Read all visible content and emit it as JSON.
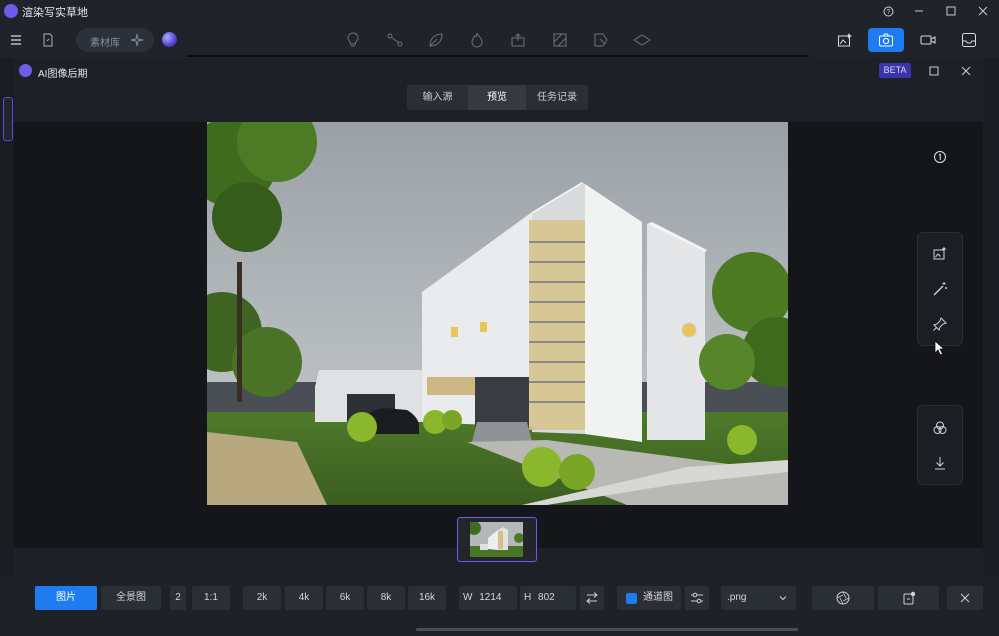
{
  "app": {
    "title": "渲染写实草地"
  },
  "toolbar": {
    "search_label": "素材库"
  },
  "dialog": {
    "title": "AI图像后期",
    "badge": "BETA",
    "tabs": [
      {
        "label": "输入源"
      },
      {
        "label": "预览"
      },
      {
        "label": "任务记录"
      }
    ],
    "info_badge": "①"
  },
  "bottom": {
    "mode_image": "图片",
    "mode_panorama": "全景图",
    "stub": "2",
    "ratio": "1:1",
    "sizes": [
      "2k",
      "4k",
      "6k",
      "8k",
      "16k"
    ],
    "width_label": "W",
    "width_value": "1214",
    "height_label": "H",
    "height_value": "802",
    "channel_label": "通道图",
    "format": ".png"
  },
  "colors": {
    "accent": "#1f7cf0",
    "brand": "#6c5ce7",
    "badge_bg": "#3a34a8"
  },
  "icons": {
    "toolbar": [
      "menu-icon",
      "file-icon",
      "sparkle-icon",
      "orb-icon",
      "bulb-icon",
      "graph-icon",
      "leaf-icon",
      "flame-icon",
      "export-icon",
      "frame-icon",
      "cursor-tag-icon",
      "layers-icon",
      "image-edit-icon",
      "camera-icon",
      "video-icon",
      "inbox-icon"
    ],
    "tools": [
      "image-edit-icon",
      "magic-wand-icon",
      "pin-icon",
      "color-circles-icon",
      "download-icon"
    ]
  }
}
